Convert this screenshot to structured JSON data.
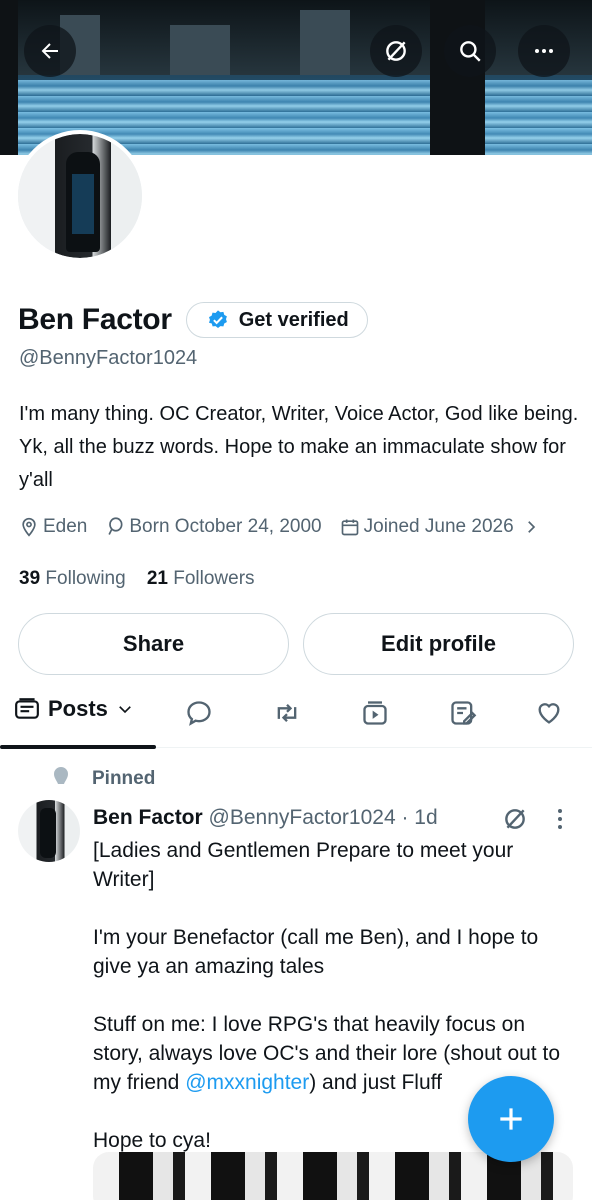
{
  "header": {
    "back_icon": "arrow-left-icon",
    "grok_icon": "grok-icon",
    "search_icon": "search-icon",
    "more_icon": "more-horizontal-icon"
  },
  "profile": {
    "display_name": "Ben Factor",
    "verify_label": "Get verified",
    "handle": "@BennyFactor1024",
    "bio": "I'm many thing. OC Creator, Writer, Voice Actor, God like being. Yk, all the buzz words. Hope to make an immaculate show for y'all",
    "location": "Eden",
    "born": "Born October 24, 2000",
    "joined": "Joined June 2026",
    "following_count": "39",
    "following_label": "Following",
    "followers_count": "21",
    "followers_label": "Followers",
    "share_label": "Share",
    "edit_label": "Edit profile"
  },
  "tabs": {
    "posts_label": "Posts",
    "icons": [
      "reply-icon",
      "repost-icon",
      "media-icon",
      "articles-icon",
      "like-icon"
    ]
  },
  "pinned_post": {
    "pinned_label": "Pinned",
    "author_name": "Ben Factor",
    "author_meta": "@BennyFactor1024 · 1d",
    "text_before_mention": "[Ladies and Gentlemen Prepare to meet your Writer]\n\nI'm your Benefactor (call me Ben), and I hope to give ya an amazing tales\n\nStuff on me: I love RPG's that heavily focus on story, always love OC's and their lore (shout out to my friend ",
    "mention": "@mxxnighter",
    "text_after_mention": ") and just Fluff\n\nHope to cya!"
  },
  "colors": {
    "accent": "#1d9bf0",
    "text_primary": "#0f1419",
    "text_secondary": "#536471",
    "border": "#cfd9de"
  }
}
